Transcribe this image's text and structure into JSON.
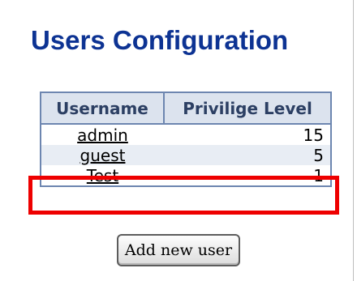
{
  "page": {
    "title": "Users Configuration"
  },
  "table": {
    "headers": {
      "username": "Username",
      "level": "Privilige Level"
    },
    "rows": [
      {
        "username": "admin",
        "level": "15"
      },
      {
        "username": "guest",
        "level": "5"
      },
      {
        "username": "Test",
        "level": "1"
      }
    ]
  },
  "actions": {
    "add_label": "Add new user"
  },
  "colors": {
    "title": "#0d3393",
    "header_bg": "#dce3ee",
    "border": "#6d86b0",
    "highlight": "#ee0000"
  }
}
